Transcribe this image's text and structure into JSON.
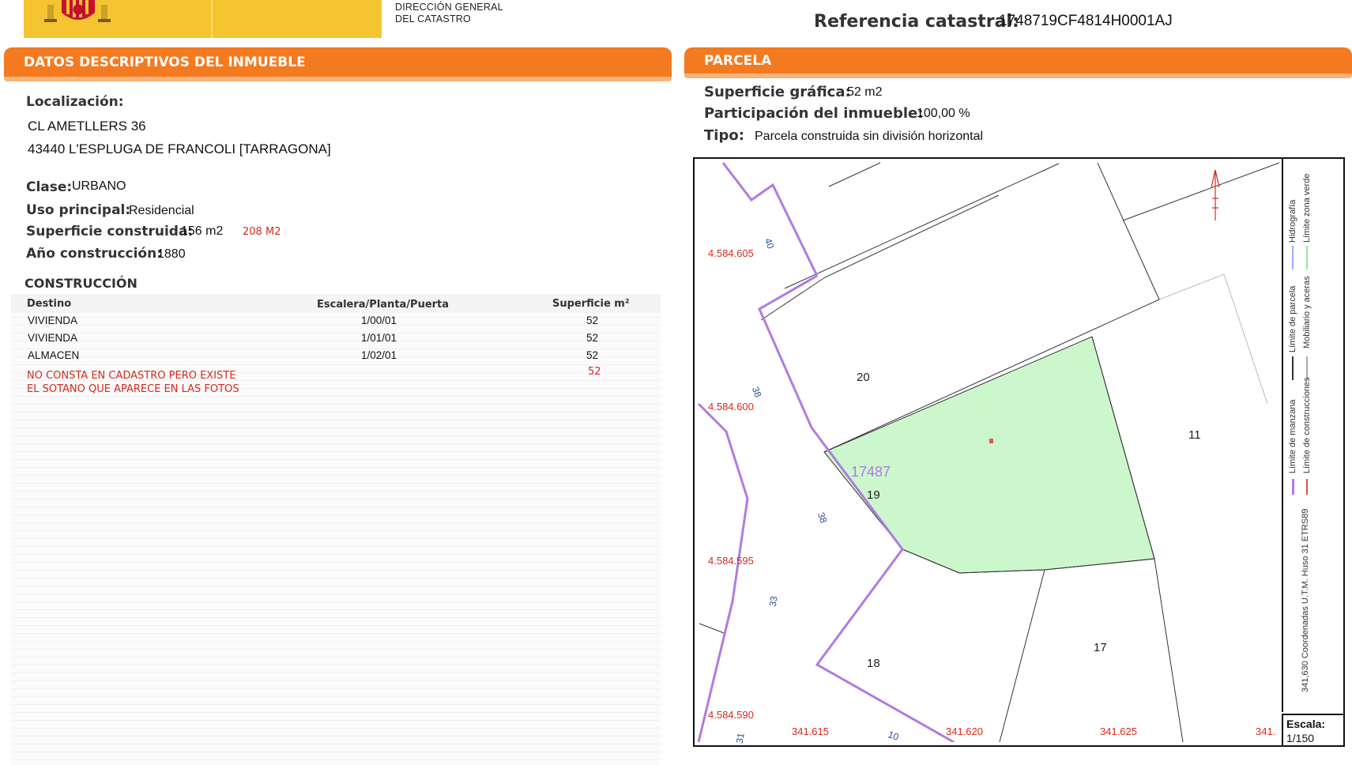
{
  "header": {
    "agency_line1": "DIRECCIÓN GENERAL",
    "agency_line2": "DEL CATASTRO",
    "refcat_label": "Referencia catastral:",
    "refcat_value": "1748719CF4814H0001AJ"
  },
  "colors": {
    "orange": "#f47a20",
    "yellow": "#f5c431",
    "green_parcel": "#ccf7cc",
    "purple": "#b07be0",
    "red": "#d42a1c"
  },
  "left_panel": {
    "title": "DATOS DESCRIPTIVOS DEL INMUEBLE",
    "localizacion_label": "Localización:",
    "address_line1": "CL AMETLLERS 36",
    "address_line2": "43440 L'ESPLUGA DE FRANCOLI [TARRAGONA]",
    "clase_label": "Clase:",
    "clase_value": "URBANO",
    "uso_label": "Uso principal:",
    "uso_value": "Residencial",
    "superficie_label": "Superficie construida:",
    "superficie_value": "156 m2",
    "superficie_note": "208 M2",
    "anio_label": "Año construcción:",
    "anio_value": "1880",
    "construccion_title": "CONSTRUCCIÓN",
    "table": {
      "headers": [
        "Destino",
        "Escalera/Planta/Puerta",
        "Superficie m²"
      ],
      "rows": [
        [
          "VIVIENDA",
          "1/00/01",
          "52"
        ],
        [
          "VIVIENDA",
          "1/01/01",
          "52"
        ],
        [
          "ALMACEN",
          "1/02/01",
          "52"
        ]
      ]
    },
    "note_line1": "NO CONSTA EN CADASTRO PERO EXISTE",
    "note_line2": "EL SOTANO QUE APARECE EN LAS FOTOS",
    "note_value": "52"
  },
  "right_panel": {
    "title": "PARCELA",
    "sup_grafica_label": "Superficie gráfica:",
    "sup_grafica_value": "52 m2",
    "participacion_label": "Participación del inmueble:",
    "participacion_value": "100,00 %",
    "tipo_label": "Tipo:",
    "tipo_value": "Parcela construida sin división horizontal"
  },
  "map": {
    "y_labels": [
      "4.584.605",
      "4.584.600",
      "4.584.595",
      "4.584.590"
    ],
    "x_labels": [
      "341.615",
      "341.620",
      "341.625",
      "341."
    ],
    "parcel_labels": [
      "20",
      "19",
      "18",
      "17",
      "11"
    ],
    "block_label": "17487",
    "street_numbers": [
      "40",
      "38",
      "38",
      "33",
      "31",
      "10"
    ],
    "legend": {
      "hidrografia": "Hidrografía",
      "limite_zona_verde": "Límite zona verde",
      "limite_parcela": "Límite de parcela",
      "mobiliario": "Mobiliario y aceras",
      "limite_manzana": "Límite de manzana",
      "limite_construcciones": "Límite de construcciones",
      "coordenadas": "341,630 Coordenadas U.T.M. Huso 31 ETRS89"
    },
    "scale_label": "Escala:",
    "scale_value": "1/150"
  }
}
